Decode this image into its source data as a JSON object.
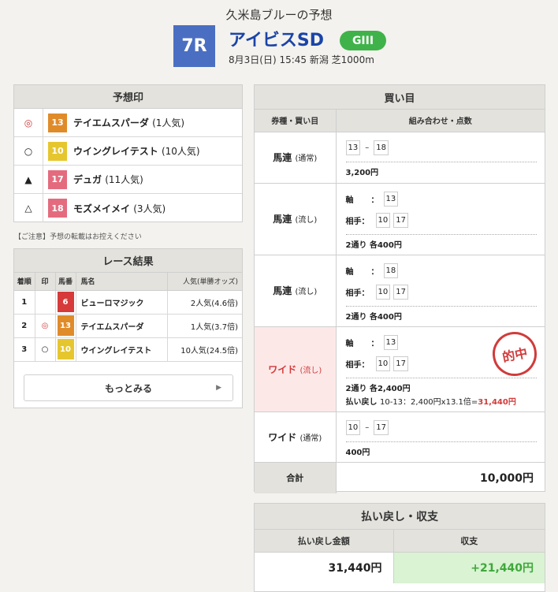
{
  "header": {
    "title": "久米島ブルーの予想",
    "race_no": "7R",
    "race_name": "アイビスSD",
    "grade": "GIII",
    "meta": "8月3日(日) 15:45 新潟 芝1000m"
  },
  "prediction": {
    "title": "予想印",
    "rows": [
      {
        "mark": "◎",
        "num": "13",
        "color": "#e08b2a",
        "name": "テイエムスパーダ",
        "pop": "(1人気)"
      },
      {
        "mark": "○",
        "num": "10",
        "color": "#e6c62e",
        "name": "ウイングレイテスト",
        "pop": "(10人気)"
      },
      {
        "mark": "▲",
        "num": "17",
        "color": "#e46b7e",
        "name": "デュガ",
        "pop": "(11人気)"
      },
      {
        "mark": "△",
        "num": "18",
        "color": "#e46b7e",
        "name": "モズメイメイ",
        "pop": "(3人気)"
      }
    ],
    "notice": "【ご注意】予想の転載はお控えください"
  },
  "results": {
    "title": "レース結果",
    "headers": [
      "着順",
      "印",
      "馬番",
      "馬名",
      "人気(単勝オッズ)"
    ],
    "rows": [
      {
        "rank": "1",
        "mark": "",
        "num": "6",
        "color": "#d63a3a",
        "name": "ビューロマジック",
        "pop": "2人気(4.6倍)"
      },
      {
        "rank": "2",
        "mark": "◎",
        "num": "13",
        "color": "#e08b2a",
        "name": "テイエムスパーダ",
        "pop": "1人気(3.7倍)"
      },
      {
        "rank": "3",
        "mark": "○",
        "num": "10",
        "color": "#e6c62e",
        "name": "ウイングレイテスト",
        "pop": "10人気(24.5倍)"
      }
    ],
    "more_label": "もっとみる"
  },
  "bets": {
    "title": "買い目",
    "col1": "券種・買い目",
    "col2": "組み合わせ・点数",
    "axis_label": "軸",
    "partner_label": "相手：",
    "rows": [
      {
        "type": "馬連",
        "sub": "(通常)",
        "combo": [
          "13",
          "18"
        ],
        "amount": "3,200円"
      },
      {
        "type": "馬連",
        "sub": "(流し)",
        "axis": "13",
        "partners": [
          "10",
          "17"
        ],
        "amount": "2通り 各400円"
      },
      {
        "type": "馬連",
        "sub": "(流し)",
        "axis": "18",
        "partners": [
          "10",
          "17"
        ],
        "amount": "2通り 各400円"
      },
      {
        "type": "ワイド",
        "sub": "(流し)",
        "axis": "13",
        "partners": [
          "10",
          "17"
        ],
        "amount": "2通り 各2,400円",
        "payout_label": "払い戻し",
        "payout_detail": "10-13：2,400円x13.1倍=",
        "payout_value": "31,440円",
        "stamp": "的中"
      },
      {
        "type": "ワイド",
        "sub": "(通常)",
        "combo": [
          "10",
          "17"
        ],
        "amount": "400円"
      }
    ],
    "total_label": "合計",
    "total_value": "10,000円"
  },
  "summary": {
    "title": "払い戻し・収支",
    "col1": "払い戻し金額",
    "col2": "収支",
    "payout": "31,440円",
    "balance": "+21,440円"
  }
}
